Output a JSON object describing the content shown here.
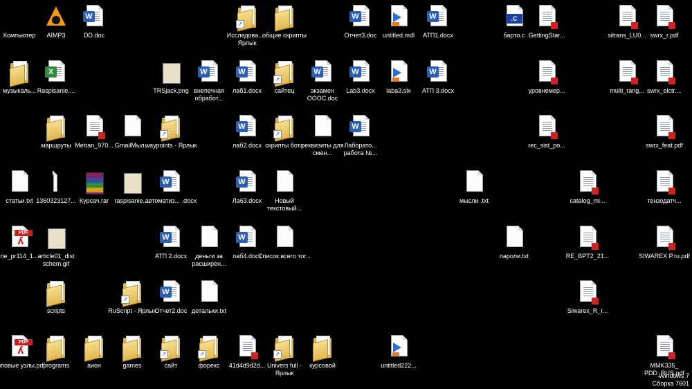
{
  "desktop": {
    "icons": [
      {
        "label": "Компьютер",
        "type": "computer",
        "icon": "computer-icon",
        "col": 0,
        "row": 0
      },
      {
        "label": "AIMP3",
        "type": "aimp",
        "icon": "aimp-icon",
        "col": 1,
        "row": 0
      },
      {
        "label": "DD.doc",
        "type": "word",
        "icon": "word-document-icon",
        "col": 2,
        "row": 0
      },
      {
        "label": "Исследова... - Ярлык",
        "type": "folder",
        "shortcut": true,
        "icon": "folder-shortcut-icon",
        "col": 6,
        "row": 0
      },
      {
        "label": "общие скрипты",
        "type": "folder",
        "icon": "folder-icon",
        "col": 7,
        "row": 0
      },
      {
        "label": "Отчет3.doc",
        "type": "word",
        "icon": "word-document-icon",
        "col": 9,
        "row": 0
      },
      {
        "label": "untitled.mdl",
        "type": "mdl",
        "icon": "simulink-model-icon",
        "col": 10,
        "row": 0
      },
      {
        "label": "АТП1.docx",
        "type": "word",
        "icon": "word-document-icon",
        "col": 11,
        "row": 0
      },
      {
        "label": "барто.c",
        "type": "cfile",
        "icon": "c-source-icon",
        "col": 13,
        "row": 0
      },
      {
        "label": "GettingStar...",
        "type": "pdfthumb",
        "icon": "pdf-thumbnail-icon",
        "col": 14,
        "row": 0
      },
      {
        "label": "sitrans_LU0...",
        "type": "pdfthumb",
        "icon": "pdf-thumbnail-icon",
        "col": 16,
        "row": 0
      },
      {
        "label": "swrx_r.pdf",
        "type": "pdfthumb",
        "icon": "pdf-thumbnail-icon",
        "col": 17,
        "row": 0
      },
      {
        "label": "музыкаль...",
        "type": "folder",
        "icon": "folder-icon",
        "col": 0,
        "row": 1
      },
      {
        "label": "Raspisanie....",
        "type": "excel",
        "icon": "excel-document-icon",
        "col": 1,
        "row": 1
      },
      {
        "label": "TRSjack.png",
        "type": "img",
        "icon": "image-file-icon",
        "col": 4,
        "row": 1
      },
      {
        "label": "внепечная обработ...",
        "type": "word",
        "icon": "word-document-icon",
        "col": 5,
        "row": 1
      },
      {
        "label": "лаб1.docx",
        "type": "word",
        "icon": "word-document-icon",
        "col": 6,
        "row": 1
      },
      {
        "label": "сайтец",
        "type": "folder",
        "shortcut": true,
        "icon": "folder-shortcut-icon",
        "col": 7,
        "row": 1
      },
      {
        "label": "экзамен ОООС.doc",
        "type": "word",
        "icon": "word-document-icon",
        "col": 8,
        "row": 1
      },
      {
        "label": "Lab3.docx",
        "type": "word",
        "icon": "word-document-icon",
        "col": 9,
        "row": 1
      },
      {
        "label": "laba3.slx",
        "type": "mdl",
        "icon": "simulink-model-icon",
        "col": 10,
        "row": 1
      },
      {
        "label": "АТП 3.docx",
        "type": "word",
        "icon": "word-document-icon",
        "col": 11,
        "row": 1
      },
      {
        "label": "уровнемер...",
        "type": "pdfthumb",
        "icon": "pdf-thumbnail-icon",
        "col": 14,
        "row": 1
      },
      {
        "label": "multi_rang...",
        "type": "pdfthumb",
        "icon": "pdf-thumbnail-icon",
        "col": 16,
        "row": 1
      },
      {
        "label": "swrx_elctr....",
        "type": "pdfthumb",
        "icon": "pdf-thumbnail-icon",
        "col": 17,
        "row": 1
      },
      {
        "label": "маршруты",
        "type": "folder",
        "icon": "folder-icon",
        "col": 1,
        "row": 2
      },
      {
        "label": "Metran_970...",
        "type": "pdfthumb",
        "icon": "pdf-thumbnail-icon",
        "col": 2,
        "row": 2
      },
      {
        "label": "GmailМыл...",
        "type": "txt",
        "icon": "text-file-icon",
        "col": 3,
        "row": 2
      },
      {
        "label": "waypoints - Ярлык",
        "type": "folder",
        "shortcut": true,
        "icon": "folder-shortcut-icon",
        "col": 4,
        "row": 2
      },
      {
        "label": "лаб2.docx",
        "type": "word",
        "icon": "word-document-icon",
        "col": 6,
        "row": 2
      },
      {
        "label": "скрипты бота",
        "type": "folder",
        "shortcut": true,
        "icon": "folder-shortcut-icon",
        "col": 7,
        "row": 2
      },
      {
        "label": "реквизиты для смен...",
        "type": "txt",
        "icon": "text-file-icon",
        "col": 8,
        "row": 2
      },
      {
        "label": "Лаборато... работа №...",
        "type": "word",
        "icon": "word-document-icon",
        "col": 9,
        "row": 2
      },
      {
        "label": "rec_sist_po...",
        "type": "pdfthumb",
        "icon": "pdf-thumbnail-icon",
        "col": 14,
        "row": 2
      },
      {
        "label": "swrx_feat.pdf",
        "type": "pdfthumb",
        "icon": "pdf-thumbnail-icon",
        "col": 17,
        "row": 2
      },
      {
        "label": "статьи.txt",
        "type": "txt",
        "icon": "text-file-icon",
        "col": 0,
        "row": 3
      },
      {
        "label": "1360323127...",
        "type": "thin",
        "icon": "image-file-icon",
        "col": 1,
        "row": 3
      },
      {
        "label": "Курсач.rar",
        "type": "rar",
        "icon": "winrar-archive-icon",
        "col": 2,
        "row": 3
      },
      {
        "label": "raspisanie....",
        "type": "img",
        "icon": "image-file-icon",
        "col": 3,
        "row": 3
      },
      {
        "label": "автоматиз... .docx",
        "type": "word",
        "icon": "word-document-icon",
        "col": 4,
        "row": 3
      },
      {
        "label": "Ла63.docx",
        "type": "word",
        "icon": "word-document-icon",
        "col": 6,
        "row": 3
      },
      {
        "label": "Новый текстовый...",
        "type": "txt",
        "icon": "text-file-icon",
        "col": 7,
        "row": 3
      },
      {
        "label": "мысли .txt",
        "type": "txt",
        "icon": "text-file-icon",
        "col": 12,
        "row": 3
      },
      {
        "label": "catalog_mi...",
        "type": "pdfthumb",
        "icon": "pdf-thumbnail-icon",
        "col": 15,
        "row": 3
      },
      {
        "label": "тензодатч...",
        "type": "pdfthumb",
        "icon": "pdf-thumbnail-icon",
        "col": 17,
        "row": 3
      },
      {
        "label": "rie_pr114_1...",
        "type": "pdf",
        "icon": "pdf-file-icon",
        "col": 0,
        "row": 4
      },
      {
        "label": "article01_dist schem.gif",
        "type": "img",
        "icon": "image-file-icon",
        "col": 1,
        "row": 4
      },
      {
        "label": "АТП 2.docx",
        "type": "word",
        "icon": "word-document-icon",
        "col": 4,
        "row": 4
      },
      {
        "label": "деньги за расширен...",
        "type": "txt",
        "icon": "text-file-icon",
        "col": 5,
        "row": 4
      },
      {
        "label": "лаб4.docx",
        "type": "word",
        "icon": "word-document-icon",
        "col": 6,
        "row": 4
      },
      {
        "label": "Список всего тог...",
        "type": "txt",
        "icon": "text-file-icon",
        "col": 7,
        "row": 4
      },
      {
        "label": "пароли.txt",
        "type": "txt",
        "icon": "text-file-icon",
        "col": 13,
        "row": 4
      },
      {
        "label": "RE_BPT2_21...",
        "type": "pdfthumb",
        "icon": "pdf-thumbnail-icon",
        "col": 15,
        "row": 4
      },
      {
        "label": "SIWAREX P.ru.pdf",
        "type": "pdfthumb",
        "icon": "pdf-thumbnail-icon",
        "col": 17,
        "row": 4
      },
      {
        "label": "scripts",
        "type": "folder",
        "icon": "folder-icon",
        "col": 1,
        "row": 5
      },
      {
        "label": "RuScript - Ярлык",
        "type": "folder",
        "shortcut": true,
        "icon": "folder-shortcut-icon",
        "col": 3,
        "row": 5
      },
      {
        "label": "Отчет2.doc",
        "type": "word",
        "icon": "word-document-icon",
        "col": 4,
        "row": 5
      },
      {
        "label": "детальки.txt",
        "type": "txt",
        "icon": "text-file-icon",
        "col": 5,
        "row": 5
      },
      {
        "label": "Siwarex_R_r...",
        "type": "pdfthumb",
        "icon": "pdf-thumbnail-icon",
        "col": 15,
        "row": 5
      },
      {
        "label": "Типовые узлы.pdf",
        "type": "pdf",
        "icon": "pdf-file-icon",
        "col": 0,
        "row": 6
      },
      {
        "label": "programs",
        "type": "folder",
        "icon": "folder-icon",
        "col": 1,
        "row": 6
      },
      {
        "label": "аион",
        "type": "folder",
        "icon": "folder-icon",
        "col": 2,
        "row": 6
      },
      {
        "label": "games",
        "type": "folder",
        "icon": "folder-icon",
        "col": 3,
        "row": 6
      },
      {
        "label": "сайт",
        "type": "folder",
        "shortcut": true,
        "icon": "folder-shortcut-icon",
        "col": 4,
        "row": 6
      },
      {
        "label": "форекс",
        "type": "folder",
        "shortcut": true,
        "icon": "folder-shortcut-icon",
        "col": 5,
        "row": 6
      },
      {
        "label": "41d4d9d2d...",
        "type": "pdfthumb",
        "icon": "pdf-thumbnail-icon",
        "col": 6,
        "row": 6
      },
      {
        "label": "Univers full - Ярлык",
        "type": "folder",
        "shortcut": true,
        "icon": "folder-shortcut-icon",
        "col": 7,
        "row": 6
      },
      {
        "label": "курсовой",
        "type": "folder",
        "icon": "folder-icon",
        "col": 8,
        "row": 6
      },
      {
        "label": "untitled222...",
        "type": "mdl",
        "icon": "simulink-model-icon",
        "col": 10,
        "row": 6
      },
      {
        "label": "MMK335_ PDD_RUS.pdf",
        "type": "pdfthumb",
        "icon": "pdf-thumbnail-icon",
        "col": 17,
        "row": 6
      }
    ]
  },
  "watermark": {
    "line1": "Windows 7",
    "line2": "Сборка 7601"
  }
}
